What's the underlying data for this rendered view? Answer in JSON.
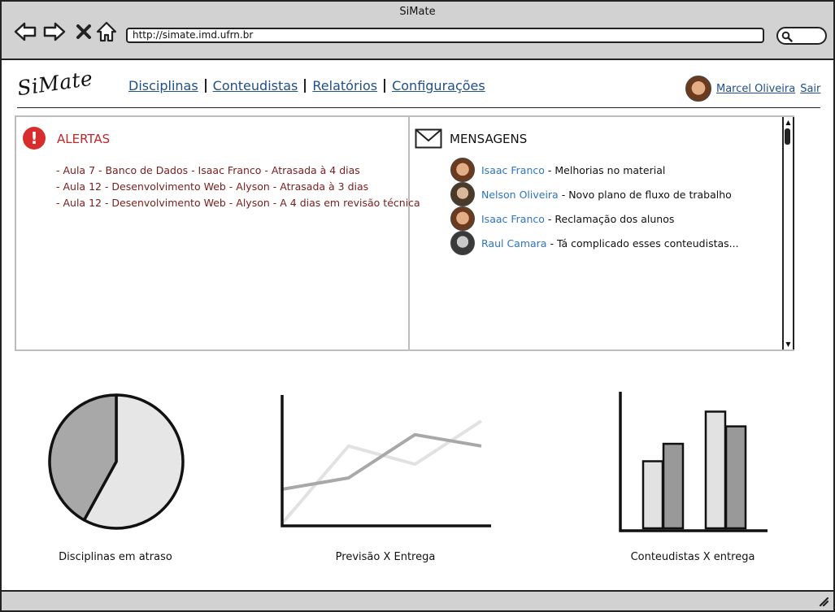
{
  "window": {
    "title": "SiMate",
    "url": "http://simate.imd.ufrn.br"
  },
  "logo": "SiMate",
  "menu": [
    "Disciplinas",
    "Conteudistas",
    "Relatórios",
    "Configurações"
  ],
  "user": {
    "name": "Marcel Oliveira",
    "logout": "Sair"
  },
  "alerts": {
    "title": "ALERTAS",
    "items": [
      "- Aula 7 - Banco de Dados - Isaac Franco - Atrasada à 4 dias",
      "- Aula 12 - Desenvolvimento Web - Alyson - Atrasada à 3 dias",
      "- Aula 12 - Desenvolvimento Web - Alyson - A 4 dias em revisão técnica"
    ]
  },
  "messages": {
    "title": "MENSAGENS",
    "items": [
      {
        "name": "Isaac Franco",
        "text": "- Melhorias no material"
      },
      {
        "name": "Nelson Oliveira",
        "text": "- Novo plano de fluxo de trabalho"
      },
      {
        "name": "Isaac Franco",
        "text": "- Reclamação dos alunos"
      },
      {
        "name": "Raul Camara",
        "text": "- Tá complicado esses conteudistas..."
      }
    ]
  },
  "colors": {
    "link": "#1f4f8a",
    "alert": "#c0262b",
    "name": "#2f74c0",
    "chrome": "#d2d2d2"
  },
  "chart_data": [
    {
      "type": "pie",
      "title": "Disciplinas em atraso",
      "values": [
        58,
        42
      ],
      "colors": [
        "#e6e6e6",
        "#a8a8a8"
      ]
    },
    {
      "type": "line",
      "title": "Previsão X Entrega",
      "x": [
        0,
        1,
        2,
        3
      ],
      "series": [
        {
          "values": [
            0,
            68,
            52,
            90
          ],
          "color": "#e2e2e2"
        },
        {
          "values": [
            30,
            40,
            78,
            68
          ],
          "color": "#a8a8a8"
        }
      ],
      "ylim": [
        0,
        100
      ]
    },
    {
      "type": "bar",
      "title": "Conteudistas X entrega",
      "series": [
        {
          "values": [
            50,
            87
          ],
          "color": "#e2e2e2"
        },
        {
          "values": [
            63,
            76
          ],
          "color": "#999999"
        }
      ],
      "ylim": [
        0,
        100
      ]
    }
  ]
}
